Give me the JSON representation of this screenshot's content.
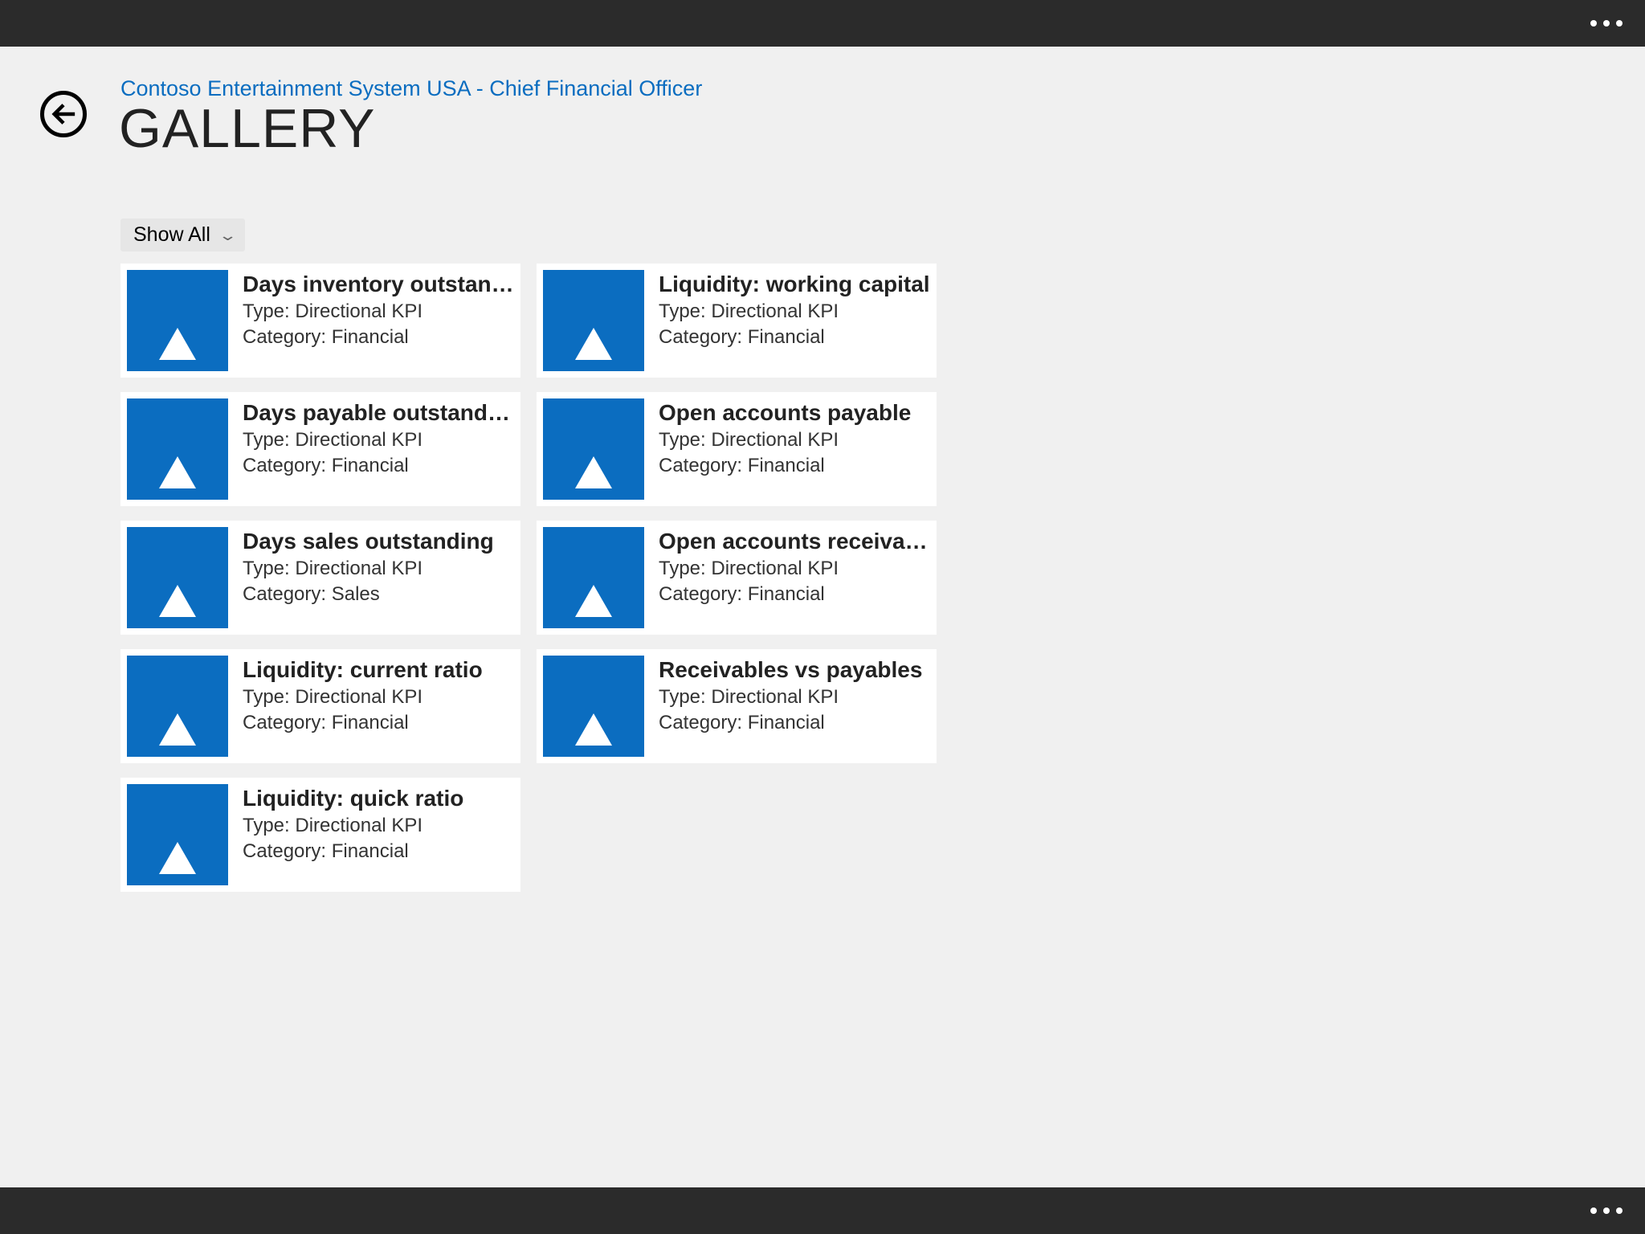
{
  "header": {
    "breadcrumb": "Contoso Entertainment System USA - Chief Financial Officer",
    "title": "GALLERY"
  },
  "filter": {
    "label": "Show All"
  },
  "labels": {
    "type_prefix": "Type: ",
    "category_prefix": "Category: "
  },
  "tiles": [
    {
      "title": "Days inventory outstanding",
      "type": "Directional KPI",
      "category": "Financial"
    },
    {
      "title": "Days payable outstanding",
      "type": "Directional KPI",
      "category": "Financial"
    },
    {
      "title": "Days sales outstanding",
      "type": "Directional KPI",
      "category": "Sales"
    },
    {
      "title": "Liquidity: current ratio",
      "type": "Directional KPI",
      "category": "Financial"
    },
    {
      "title": "Liquidity: quick ratio",
      "type": "Directional KPI",
      "category": "Financial"
    },
    {
      "title": "Liquidity: working capital",
      "type": "Directional KPI",
      "category": "Financial"
    },
    {
      "title": "Open accounts payable",
      "type": "Directional KPI",
      "category": "Financial"
    },
    {
      "title": "Open accounts receivable",
      "type": "Directional KPI",
      "category": "Financial"
    },
    {
      "title": "Receivables vs payables",
      "type": "Directional KPI",
      "category": "Financial"
    }
  ]
}
